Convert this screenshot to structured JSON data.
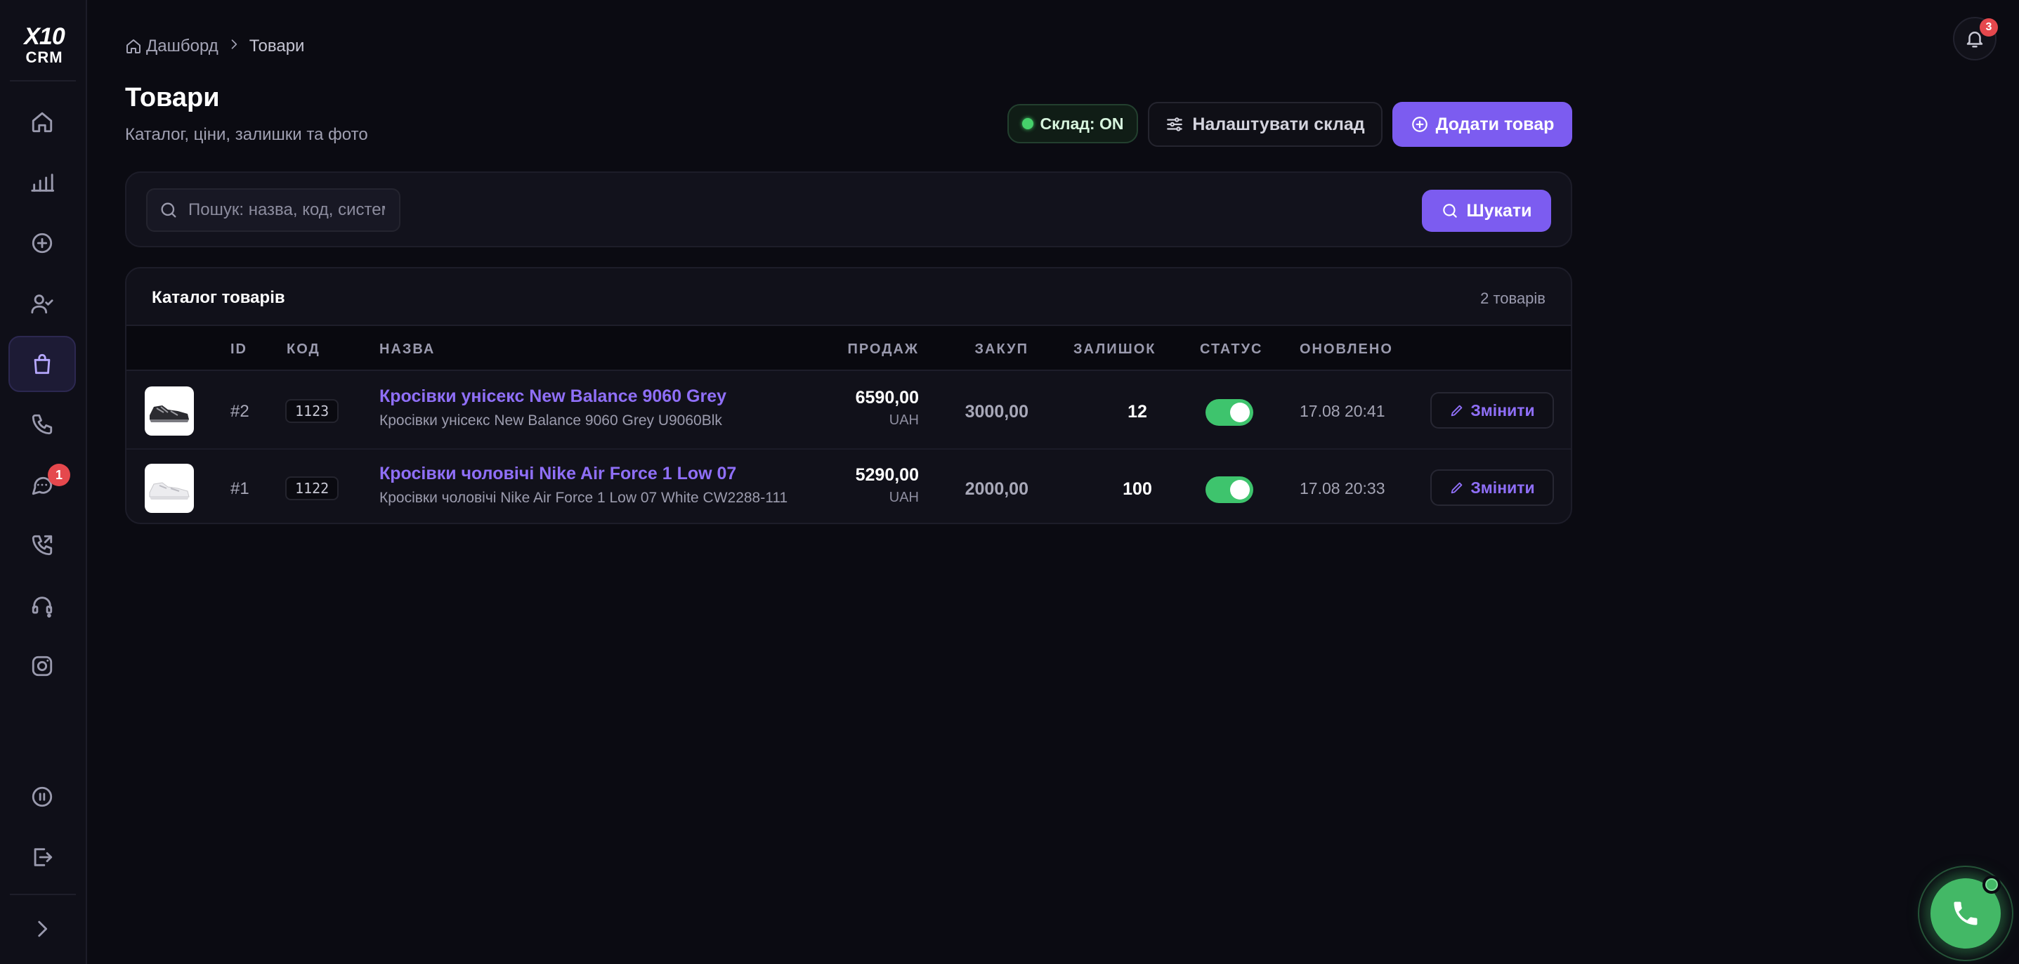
{
  "app": {
    "logo_line1": "X10",
    "logo_line2": "CRM"
  },
  "sidebar": {
    "items": [
      {
        "name": "home-icon"
      },
      {
        "name": "bar-chart-icon"
      },
      {
        "name": "plus-circle-icon"
      },
      {
        "name": "user-check-icon"
      },
      {
        "name": "shopping-bag-icon",
        "active": true
      },
      {
        "name": "phone-icon"
      },
      {
        "name": "chat-icon",
        "badge": "1"
      },
      {
        "name": "phone-outgoing-icon"
      },
      {
        "name": "headset-icon"
      },
      {
        "name": "instagram-icon"
      },
      {
        "name": "pause-circle-icon"
      },
      {
        "name": "logout-icon"
      },
      {
        "name": "chevron-right-icon"
      }
    ]
  },
  "notifications": {
    "count": "3"
  },
  "breadcrumb": {
    "home": "Дашборд",
    "current": "Товари"
  },
  "header": {
    "title": "Товари",
    "subtitle": "Каталог, ціни, залишки та фото",
    "stock_chip": "Склад: ON",
    "configure_label": "Налаштувати склад",
    "add_label": "Додати товар"
  },
  "search": {
    "placeholder": "Пошук: назва, код, системний ID",
    "value": "",
    "button_label": "Шукати"
  },
  "catalog": {
    "title": "Каталог товарів",
    "count": "2 товарів",
    "columns": {
      "id": "ID",
      "code": "КОД",
      "name": "НАЗВА",
      "sale": "ПРОДАЖ",
      "purchase": "ЗАКУП",
      "stock": "ЗАЛИШОК",
      "status": "СТАТУС",
      "updated": "ОНОВЛЕНО"
    },
    "rows": [
      {
        "id": "#2",
        "code": "1123",
        "name": "Кросівки унісекс New Balance 9060 Grey",
        "subname": "Кросівки унісекс New Balance 9060 Grey U9060Blk",
        "sale": "6590,00",
        "currency": "UAH",
        "purchase": "3000,00",
        "stock": "12",
        "status_on": true,
        "updated": "17.08 20:41",
        "edit_label": "Змінити"
      },
      {
        "id": "#1",
        "code": "1122",
        "name": "Кросівки чоловічі Nike Air Force 1 Low 07",
        "subname": "Кросівки чоловічі Nike Air Force 1 Low 07 White CW2288-111",
        "sale": "5290,00",
        "currency": "UAH",
        "purchase": "2000,00",
        "stock": "100",
        "status_on": true,
        "updated": "17.08 20:33",
        "edit_label": "Змінити"
      }
    ]
  },
  "colors": {
    "accent": "#7c5cf0",
    "success": "#3ec46d",
    "danger": "#e5484d",
    "background": "#0b0b12"
  }
}
